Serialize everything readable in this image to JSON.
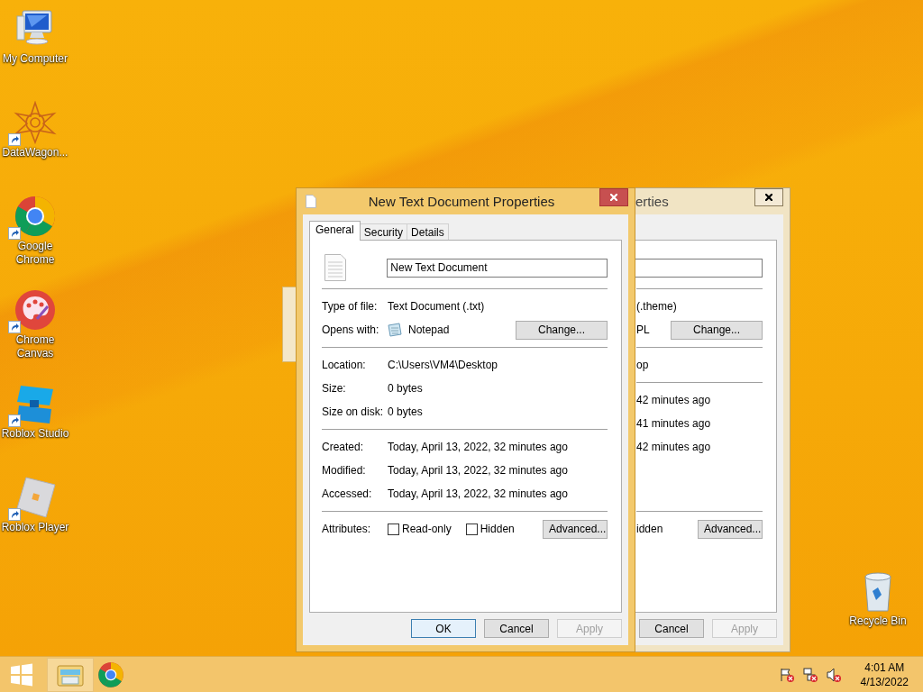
{
  "desktop_icons": [
    {
      "label": "My Computer",
      "kind": "computer",
      "shortcut": false
    },
    {
      "label": "DataWagon...",
      "kind": "star",
      "shortcut": true
    },
    {
      "label": "Google Chrome",
      "kind": "chrome",
      "shortcut": true
    },
    {
      "label": "Chrome Canvas",
      "kind": "canvas",
      "shortcut": true
    },
    {
      "label": "Roblox Studio",
      "kind": "studio",
      "shortcut": true
    },
    {
      "label": "Roblox Player",
      "kind": "player",
      "shortcut": true
    }
  ],
  "recycle_bin": {
    "label": "Recycle Bin"
  },
  "back_window": {
    "title": "erties",
    "rows": [
      {
        "value": "(.theme)"
      },
      {
        "value": "PL",
        "button": "Change..."
      },
      {
        "value": "op"
      },
      {
        "value": "42 minutes ago"
      },
      {
        "value": "41 minutes ago"
      },
      {
        "value": "42 minutes ago"
      },
      {
        "value": "idden",
        "button": "Advanced..."
      }
    ],
    "buttons": [
      {
        "label": "Cancel",
        "disabled": false
      },
      {
        "label": "Apply",
        "disabled": true
      }
    ]
  },
  "front_window": {
    "title": "New Text Document Properties",
    "tabs": [
      {
        "label": "General",
        "selected": true
      },
      {
        "label": "Security",
        "selected": false
      },
      {
        "label": "Details",
        "selected": false
      }
    ],
    "file_name": "New Text Document",
    "sections": [
      [
        {
          "label": "Type of file:",
          "value": "Text Document (.txt)"
        },
        {
          "label": "Opens with:",
          "value": "Notepad",
          "app_icon": true,
          "button": "Change..."
        }
      ],
      [
        {
          "label": "Location:",
          "value": "C:\\Users\\VM4\\Desktop"
        },
        {
          "label": "Size:",
          "value": "0 bytes"
        },
        {
          "label": "Size on disk:",
          "value": "0 bytes"
        }
      ],
      [
        {
          "label": "Created:",
          "value": "Today, April 13, 2022, 32 minutes ago"
        },
        {
          "label": "Modified:",
          "value": "Today, April 13, 2022, 32 minutes ago"
        },
        {
          "label": "Accessed:",
          "value": "Today, April 13, 2022, 32 minutes ago"
        }
      ]
    ],
    "attributes": {
      "label": "Attributes:",
      "checkboxes": [
        {
          "label": "Read-only",
          "checked": false
        },
        {
          "label": "Hidden",
          "checked": false
        }
      ],
      "button": "Advanced..."
    },
    "buttons": [
      {
        "label": "OK",
        "disabled": false,
        "default": true
      },
      {
        "label": "Cancel",
        "disabled": false,
        "default": false
      },
      {
        "label": "Apply",
        "disabled": true,
        "default": false
      }
    ]
  },
  "taskbar": {
    "items": [
      {
        "kind": "start",
        "running": false
      },
      {
        "kind": "explorer",
        "running": true
      },
      {
        "kind": "chrome",
        "running": false
      }
    ],
    "clock": {
      "time": "4:01 AM",
      "date": "4/13/2022"
    }
  }
}
